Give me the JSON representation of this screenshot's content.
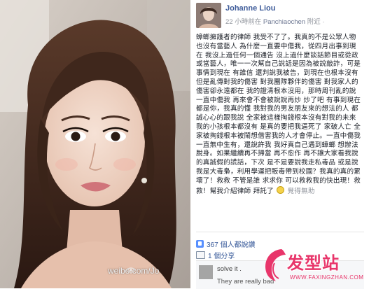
{
  "post": {
    "author": "Johanne Liou",
    "meta_time": "22 小時前在",
    "meta_place": "Panchiaochen",
    "meta_suffix": "附近 ·",
    "body_1": "蟑螂擁護者的律師 我受不了了。我真的不是公眾人物也沒有當藝人 為什麼一直要中傷我，從四月出事到現在 我沒上過任何一個通告 沒上過什麼談話節目或從政或當藝人，唯一一次幫自己說話是因為被說敲詐，可是事情到現在 有誰信 還判說我被告，到現在也根本沒有 但是亂傳對我的傷害 對我團隊夥伴的傷害 對我家人的傷害卻永遠都在 我的證清根本沒用，那時周刊亂的說 一直中傷我 再來會不會被說說再炒 炒了吧 有事到現在都是你，我真的懂 我對我的男友朋友來的想法的人 都誠心心的跟我說 全家被這樣掏錢根本沒有對我的未來 我的小孩根本都沒有 是真的要把我逼死了 家破人亡 全家被掏錢根本被鬧想借害我的人才會停止。一直中傷我 一直無中生有，還說許我 我好真自己遇到蟑螂 想辦法脫身。如果繼續再不掃當 再不愈作 再不讓大家看我說的真誠假的謊話，下次 是不是要說我走私毒品 或是說我是大毒梟，利用學運把販毒帶到校園？我真的真的累壞了！救救 不管是誰 求求你 可以救救我的快出現！救救！幫我介紹律師 拜託了",
    "emoji_label": "覺得無助",
    "likes": "367 個人都說讚",
    "shares": "1 個分享",
    "comment_1": "solve it .",
    "comment_2": "They are really bad"
  },
  "watermark": {
    "text": "weibo.com/Jo",
    "sub": ""
  },
  "logo": {
    "cn": "发型站",
    "url": "WWW.FAXINGZHAN.COM"
  },
  "colors": {
    "link": "#3b5998",
    "logo": "#e8356a",
    "text": "#1d2129"
  }
}
